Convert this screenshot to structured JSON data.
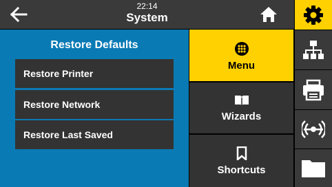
{
  "header": {
    "time": "22:14",
    "title": "System"
  },
  "panel": {
    "title": "Restore Defaults",
    "items": [
      {
        "label": "Restore Printer"
      },
      {
        "label": "Restore Network"
      },
      {
        "label": "Restore Last Saved"
      }
    ]
  },
  "nav": {
    "menu": {
      "label": "Menu",
      "icon": "menu-grid-icon"
    },
    "wizards": {
      "label": "Wizards",
      "icon": "book-icon"
    },
    "shortcuts": {
      "label": "Shortcuts",
      "icon": "bookmark-icon"
    }
  },
  "sidebar": {
    "items": [
      {
        "icon": "gear-icon",
        "active": true
      },
      {
        "icon": "network-icon"
      },
      {
        "icon": "printer-icon"
      },
      {
        "icon": "rfid-icon"
      },
      {
        "icon": "folder-icon"
      }
    ]
  },
  "colors": {
    "accent": "#ffd100",
    "panel": "#0a7ab5",
    "button": "#333333",
    "header": "#3a3a3a"
  }
}
